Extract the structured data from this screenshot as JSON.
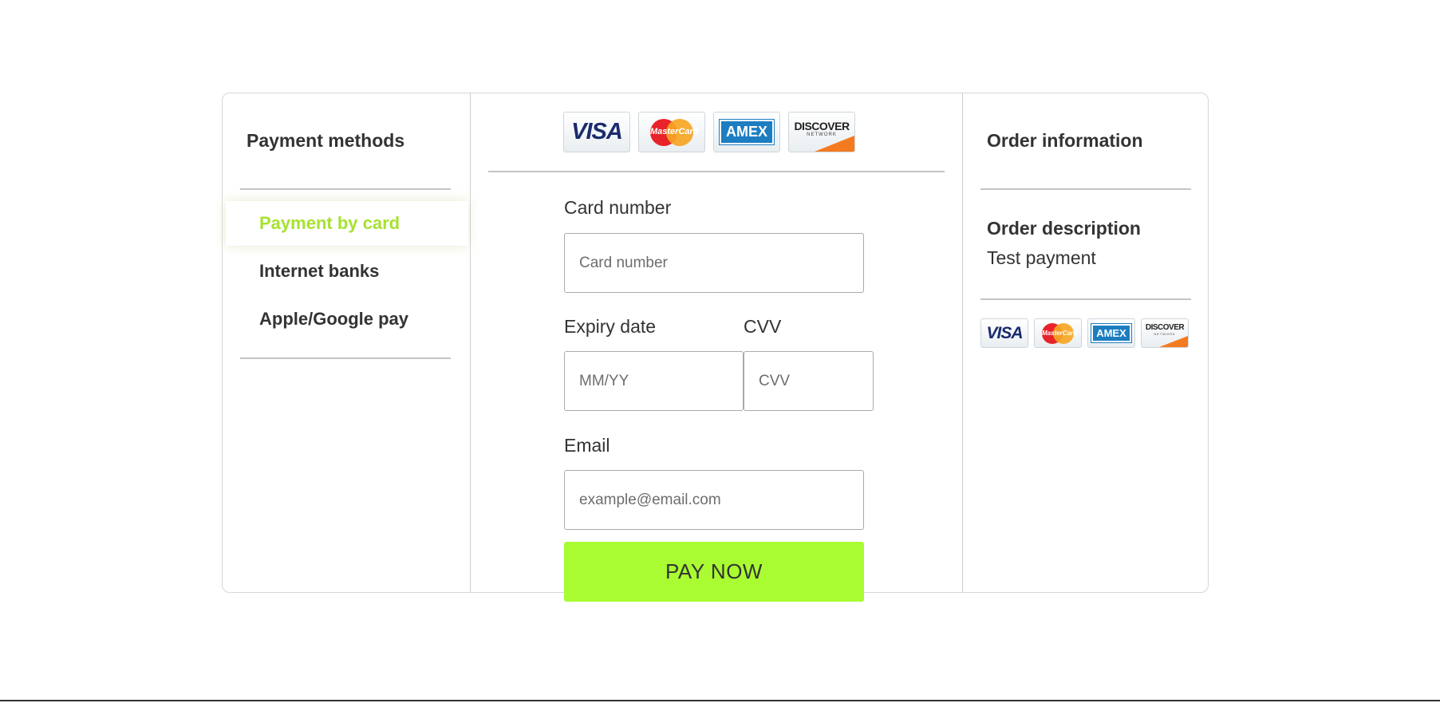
{
  "payment_methods": {
    "title": "Payment methods",
    "items": [
      {
        "label": "Payment by card",
        "active": true
      },
      {
        "label": "Internet banks",
        "active": false
      },
      {
        "label": "Apple/Google pay",
        "active": false
      }
    ]
  },
  "card_logos": [
    {
      "name": "visa-logo",
      "text": "VISA"
    },
    {
      "name": "mastercard-logo",
      "text": "MasterCard"
    },
    {
      "name": "amex-logo",
      "text": "AMEX"
    },
    {
      "name": "discover-logo",
      "text": "DISCOVER",
      "subtext": "NETWORK"
    }
  ],
  "form": {
    "card_number_label": "Card number",
    "card_number_placeholder": "Card number",
    "expiry_label": "Expiry date",
    "expiry_placeholder": "MM/YY",
    "cvv_label": "CVV",
    "cvv_placeholder": "CVV",
    "email_label": "Email",
    "email_placeholder": "example@email.com",
    "pay_button": "PAY NOW"
  },
  "order": {
    "title": "Order information",
    "description_label": "Order description",
    "description_value": "Test payment"
  },
  "colors": {
    "accent": "#a9fc31",
    "active_method": "#a6e22e",
    "text": "#333333"
  }
}
